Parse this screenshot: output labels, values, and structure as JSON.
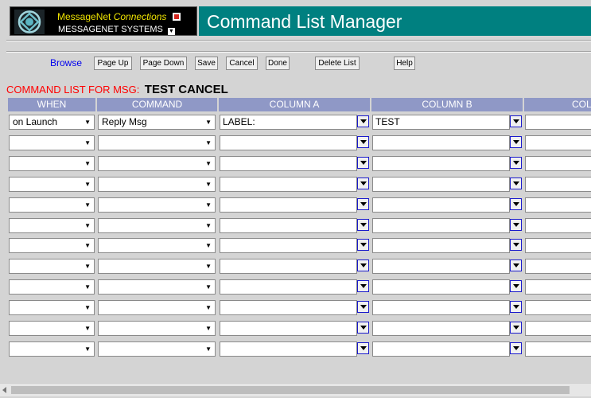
{
  "brand": {
    "name": "MessageNet",
    "product": "Connections",
    "company": "MESSAGENET SYSTEMS"
  },
  "page_title": "Command List Manager",
  "toolbar": {
    "browse_label": "Browse",
    "buttons": [
      "Page Up",
      "Page Down",
      "Save",
      "Cancel",
      "Done",
      "Delete List",
      "Help"
    ]
  },
  "list": {
    "caption_label": "COMMAND LIST FOR MSG:",
    "message_name": "TEST CANCEL"
  },
  "table": {
    "columns": [
      "WHEN",
      "COMMAND",
      "COLUMN A",
      "COLUMN B",
      "COL"
    ],
    "rows": [
      {
        "when": "on Launch",
        "command": "Reply Msg",
        "col_a": "LABEL:",
        "col_b": "TEST"
      },
      {
        "when": "",
        "command": "",
        "col_a": "",
        "col_b": ""
      },
      {
        "when": "",
        "command": "",
        "col_a": "",
        "col_b": ""
      },
      {
        "when": "",
        "command": "",
        "col_a": "",
        "col_b": ""
      },
      {
        "when": "",
        "command": "",
        "col_a": "",
        "col_b": ""
      },
      {
        "when": "",
        "command": "",
        "col_a": "",
        "col_b": ""
      },
      {
        "when": "",
        "command": "",
        "col_a": "",
        "col_b": ""
      },
      {
        "when": "",
        "command": "",
        "col_a": "",
        "col_b": ""
      },
      {
        "when": "",
        "command": "",
        "col_a": "",
        "col_b": ""
      },
      {
        "when": "",
        "command": "",
        "col_a": "",
        "col_b": ""
      },
      {
        "when": "",
        "command": "",
        "col_a": "",
        "col_b": ""
      },
      {
        "when": "",
        "command": "",
        "col_a": "",
        "col_b": ""
      }
    ]
  },
  "icons": {
    "logo": "messagenet-logo-icon",
    "dropdown": "chevron-down-icon",
    "picker": "field-picker-icon"
  },
  "colors": {
    "title_bar": "#008080",
    "column_header": "#8f98c6",
    "caption_label": "#ff0000",
    "brand_text": "#f2e600",
    "link": "#0000ee"
  }
}
